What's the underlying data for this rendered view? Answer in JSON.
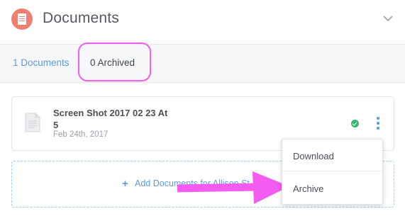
{
  "header": {
    "title": "Documents",
    "icon": "document-icon",
    "collapse_icon": "chevron-down-icon"
  },
  "tabs": [
    {
      "label": "1 Documents",
      "active": false
    },
    {
      "label": "0 Archived",
      "active": true
    }
  ],
  "document": {
    "name": "Screen Shot 2017 02 23 At 5",
    "date": "Feb 24th, 2017",
    "status_icon": "check-circle-icon",
    "menu_icon": "kebab-menu-icon"
  },
  "add_documents": {
    "label": "Add Documents for Allison St",
    "icon": "plus-icon"
  },
  "context_menu": {
    "items": [
      {
        "label": "Download"
      },
      {
        "label": "Archive"
      }
    ]
  },
  "colors": {
    "accent_blue": "#5d9be0",
    "header_icon": "#ee7f72",
    "status_green": "#33b773",
    "highlight_magenta": "#f45bf0"
  }
}
